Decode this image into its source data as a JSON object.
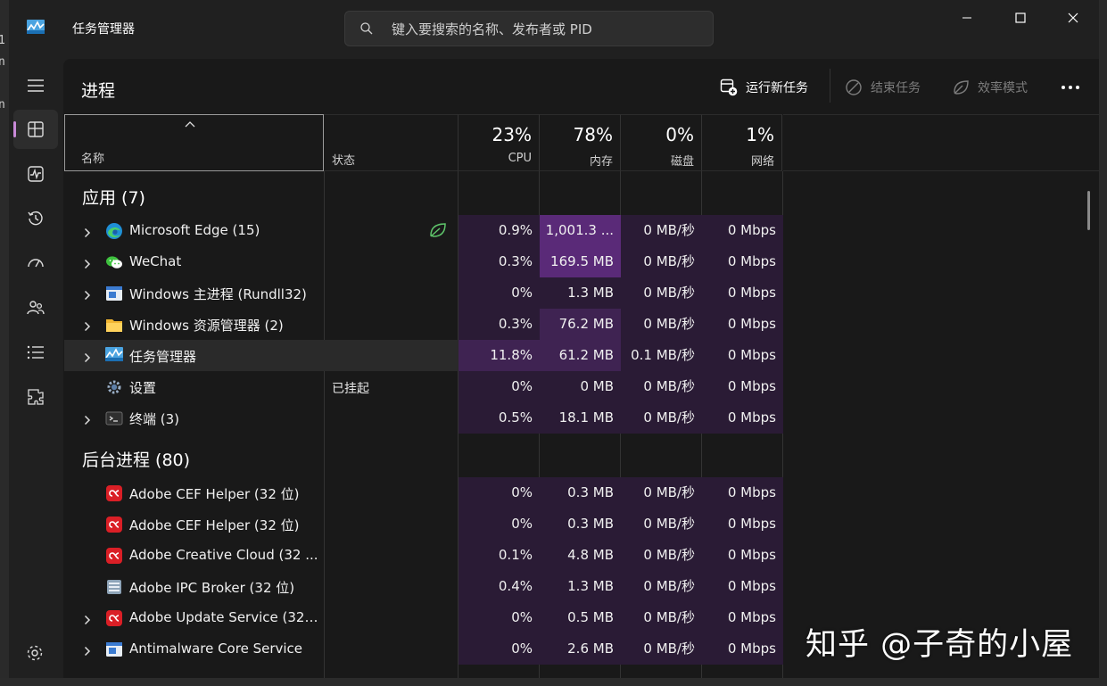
{
  "window": {
    "title": "任务管理器",
    "search_placeholder": "键入要搜索的名称、发布者或 PID"
  },
  "nav": {
    "items": [
      {
        "icon": "hamburger-menu-icon"
      },
      {
        "icon": "processes-icon",
        "active": true
      },
      {
        "icon": "performance-icon"
      },
      {
        "icon": "app-history-icon"
      },
      {
        "icon": "startup-apps-icon"
      },
      {
        "icon": "users-icon"
      },
      {
        "icon": "details-icon"
      },
      {
        "icon": "services-icon"
      }
    ],
    "settings_icon": "settings-icon"
  },
  "page": {
    "title": "进程",
    "toolbar": {
      "run_new_task": "运行新任务",
      "end_task": "结束任务",
      "efficiency_mode": "效率模式"
    }
  },
  "columns": {
    "name": "名称",
    "status": "状态",
    "cpu": {
      "pct": "23%",
      "label": "CPU"
    },
    "memory": {
      "pct": "78%",
      "label": "内存"
    },
    "disk": {
      "pct": "0%",
      "label": "磁盘"
    },
    "network": {
      "pct": "1%",
      "label": "网络"
    }
  },
  "sections": {
    "apps": "应用 (7)",
    "background": "后台进程 (80)"
  },
  "apps": [
    {
      "name": "Microsoft Edge (15)",
      "status": "",
      "eco": true,
      "expandable": true,
      "icon": "edge-icon",
      "cpu": "0.9%",
      "memory": "1,001.3 ...",
      "disk": "0 MB/秒",
      "network": "0 Mbps"
    },
    {
      "name": "WeChat",
      "status": "",
      "expandable": true,
      "icon": "wechat-icon",
      "cpu": "0.3%",
      "memory": "169.5 MB",
      "disk": "0 MB/秒",
      "network": "0 Mbps"
    },
    {
      "name": "Windows 主进程 (Rundll32)",
      "status": "",
      "expandable": true,
      "icon": "window-app-icon",
      "cpu": "0%",
      "memory": "1.3 MB",
      "disk": "0 MB/秒",
      "network": "0 Mbps"
    },
    {
      "name": "Windows 资源管理器 (2)",
      "status": "",
      "expandable": true,
      "icon": "folder-icon",
      "cpu": "0.3%",
      "memory": "76.2 MB",
      "disk": "0 MB/秒",
      "network": "0 Mbps"
    },
    {
      "name": "任务管理器",
      "status": "",
      "expandable": true,
      "highlight": true,
      "icon": "task-manager-icon",
      "cpu": "11.8%",
      "memory": "61.2 MB",
      "disk": "0.1 MB/秒",
      "network": "0 Mbps"
    },
    {
      "name": "设置",
      "status": "已挂起",
      "expandable": false,
      "icon": "gear-icon",
      "cpu": "0%",
      "memory": "0 MB",
      "disk": "0 MB/秒",
      "network": "0 Mbps"
    },
    {
      "name": "终端 (3)",
      "status": "",
      "expandable": true,
      "icon": "terminal-icon",
      "cpu": "0.5%",
      "memory": "18.1 MB",
      "disk": "0 MB/秒",
      "network": "0 Mbps"
    }
  ],
  "background": [
    {
      "name": "Adobe CEF Helper (32 位)",
      "status": "",
      "expandable": false,
      "icon": "adobe-cc-icon",
      "cpu": "0%",
      "memory": "0.3 MB",
      "disk": "0 MB/秒",
      "network": "0 Mbps"
    },
    {
      "name": "Adobe CEF Helper (32 位)",
      "status": "",
      "expandable": false,
      "icon": "adobe-cc-icon",
      "cpu": "0%",
      "memory": "0.3 MB",
      "disk": "0 MB/秒",
      "network": "0 Mbps"
    },
    {
      "name": "Adobe Creative Cloud (32 ...",
      "status": "",
      "expandable": false,
      "icon": "adobe-cc-icon",
      "cpu": "0.1%",
      "memory": "4.8 MB",
      "disk": "0 MB/秒",
      "network": "0 Mbps"
    },
    {
      "name": "Adobe IPC Broker (32 位)",
      "status": "",
      "expandable": false,
      "icon": "ipc-broker-icon",
      "cpu": "0.4%",
      "memory": "1.3 MB",
      "disk": "0 MB/秒",
      "network": "0 Mbps"
    },
    {
      "name": "Adobe Update Service (32 ...",
      "status": "",
      "expandable": true,
      "icon": "adobe-cc-icon",
      "cpu": "0%",
      "memory": "0.5 MB",
      "disk": "0 MB/秒",
      "network": "0 Mbps"
    },
    {
      "name": "Antimalware Core Service",
      "status": "",
      "expandable": true,
      "icon": "window-app-icon",
      "cpu": "0%",
      "memory": "2.6 MB",
      "disk": "0 MB/秒",
      "network": "0 Mbps"
    }
  ],
  "heat_colors": {
    "base": "#2a1b35",
    "medium": "#3f2352",
    "high": "#5a2a78"
  },
  "watermark": "知乎 @子奇的小屋"
}
